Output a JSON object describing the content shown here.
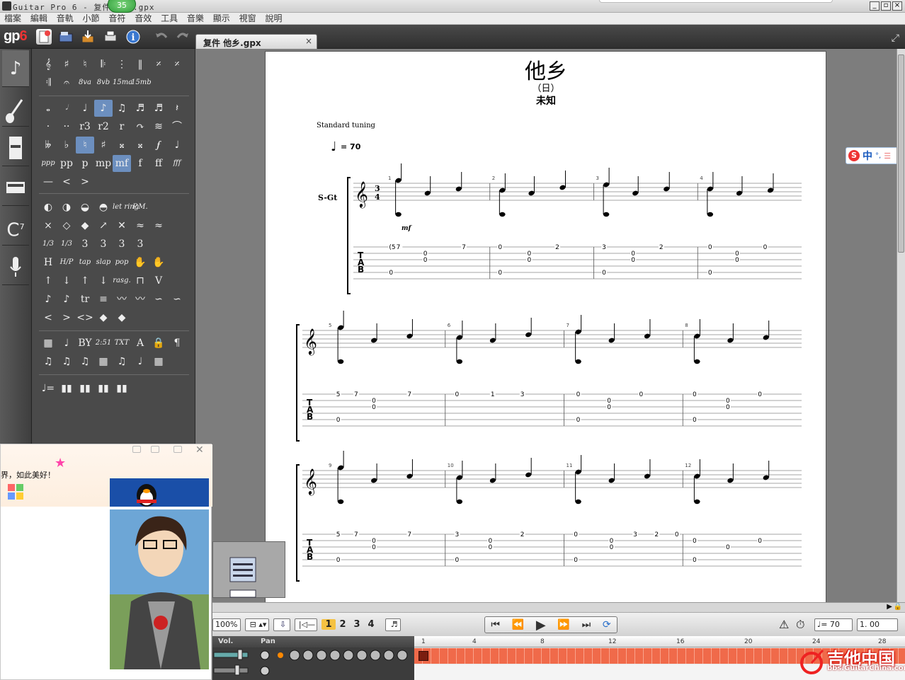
{
  "window": {
    "title": "Guitar Pro 6 - 复件 他乡.gpx",
    "notif_count": "35"
  },
  "menu": [
    "檔案",
    "編輯",
    "音軌",
    "小節",
    "音符",
    "音效",
    "工具",
    "音樂",
    "顯示",
    "視窗",
    "說明"
  ],
  "logo": {
    "text": "gp",
    "num": "6"
  },
  "tab": {
    "label": "复件 他乡.gpx",
    "close": "×"
  },
  "score": {
    "title": "他乡",
    "subtitle": "（日）",
    "artist": "未知",
    "tuning": "Standard tuning",
    "tempo": "= 70",
    "track_label": "S-Gt",
    "time_sig_top": "3",
    "time_sig_bottom": "4",
    "dynamic": "mf",
    "tab_letters": [
      "T",
      "A",
      "B"
    ],
    "systems": [
      {
        "bars": [
          1,
          2,
          3,
          4
        ],
        "tab": [
          {
            "bar": 1,
            "frets": [
              {
                "x": 0.05,
                "s": 1,
                "v": "(5)"
              },
              {
                "x": 0.12,
                "s": 1,
                "v": "7"
              },
              {
                "x": 0.38,
                "s": 2,
                "v": "0"
              },
              {
                "x": 0.38,
                "s": 3,
                "v": "0"
              },
              {
                "x": 0.75,
                "s": 1,
                "v": "7"
              },
              {
                "x": 0.05,
                "s": 5,
                "v": "0"
              }
            ]
          },
          {
            "bar": 2,
            "frets": [
              {
                "x": 0.1,
                "s": 1,
                "v": "0"
              },
              {
                "x": 0.38,
                "s": 2,
                "v": "0"
              },
              {
                "x": 0.38,
                "s": 3,
                "v": "0"
              },
              {
                "x": 0.65,
                "s": 1,
                "v": "2"
              },
              {
                "x": 0.1,
                "s": 5,
                "v": "0"
              }
            ]
          },
          {
            "bar": 3,
            "frets": [
              {
                "x": 0.1,
                "s": 1,
                "v": "3"
              },
              {
                "x": 0.38,
                "s": 2,
                "v": "0"
              },
              {
                "x": 0.38,
                "s": 3,
                "v": "0"
              },
              {
                "x": 0.65,
                "s": 1,
                "v": "2"
              },
              {
                "x": 0.1,
                "s": 5,
                "v": "0"
              }
            ]
          },
          {
            "bar": 4,
            "frets": [
              {
                "x": 0.12,
                "s": 1,
                "v": "0"
              },
              {
                "x": 0.38,
                "s": 2,
                "v": "0"
              },
              {
                "x": 0.38,
                "s": 3,
                "v": "0"
              },
              {
                "x": 0.65,
                "s": 1,
                "v": "0"
              },
              {
                "x": 0.12,
                "s": 5,
                "v": "0"
              }
            ]
          }
        ]
      },
      {
        "bars": [
          5,
          6,
          7,
          8
        ],
        "tab": [
          {
            "bar": 5,
            "frets": [
              {
                "x": 0.1,
                "s": 1,
                "v": "5"
              },
              {
                "x": 0.25,
                "s": 1,
                "v": "7"
              },
              {
                "x": 0.4,
                "s": 2,
                "v": "0"
              },
              {
                "x": 0.4,
                "s": 3,
                "v": "0"
              },
              {
                "x": 0.7,
                "s": 1,
                "v": "7"
              },
              {
                "x": 0.1,
                "s": 5,
                "v": "0"
              }
            ]
          },
          {
            "bar": 6,
            "frets": [
              {
                "x": 0.1,
                "s": 1,
                "v": "0"
              },
              {
                "x": 0.4,
                "s": 1,
                "v": "1"
              },
              {
                "x": 0.65,
                "s": 1,
                "v": "3"
              }
            ]
          },
          {
            "bar": 7,
            "frets": [
              {
                "x": 0.12,
                "s": 1,
                "v": "0"
              },
              {
                "x": 0.38,
                "s": 2,
                "v": "0"
              },
              {
                "x": 0.38,
                "s": 3,
                "v": "0"
              },
              {
                "x": 0.65,
                "s": 1,
                "v": "0"
              },
              {
                "x": 0.12,
                "s": 5,
                "v": "0"
              }
            ]
          },
          {
            "bar": 8,
            "frets": [
              {
                "x": 0.1,
                "s": 1,
                "v": "0"
              },
              {
                "x": 0.38,
                "s": 2,
                "v": "0"
              },
              {
                "x": 0.38,
                "s": 3,
                "v": "0"
              },
              {
                "x": 0.65,
                "s": 1,
                "v": "0"
              },
              {
                "x": 0.1,
                "s": 5,
                "v": "0"
              }
            ]
          }
        ]
      },
      {
        "bars": [
          9,
          10,
          11,
          12
        ],
        "tab": [
          {
            "bar": 9,
            "frets": [
              {
                "x": 0.1,
                "s": 1,
                "v": "5"
              },
              {
                "x": 0.25,
                "s": 1,
                "v": "7"
              },
              {
                "x": 0.4,
                "s": 2,
                "v": "0"
              },
              {
                "x": 0.4,
                "s": 3,
                "v": "0"
              },
              {
                "x": 0.7,
                "s": 1,
                "v": "7"
              },
              {
                "x": 0.1,
                "s": 5,
                "v": "0"
              }
            ]
          },
          {
            "bar": 10,
            "frets": [
              {
                "x": 0.1,
                "s": 1,
                "v": "3"
              },
              {
                "x": 0.38,
                "s": 2,
                "v": "0"
              },
              {
                "x": 0.38,
                "s": 3,
                "v": "0"
              },
              {
                "x": 0.65,
                "s": 1,
                "v": "2"
              },
              {
                "x": 0.1,
                "s": 5,
                "v": "0"
              }
            ]
          },
          {
            "bar": 11,
            "frets": [
              {
                "x": 0.1,
                "s": 1,
                "v": "0"
              },
              {
                "x": 0.4,
                "s": 2,
                "v": "0"
              },
              {
                "x": 0.4,
                "s": 3,
                "v": "0"
              },
              {
                "x": 0.6,
                "s": 1,
                "v": "3"
              },
              {
                "x": 0.78,
                "s": 1,
                "v": "2"
              },
              {
                "x": 0.95,
                "s": 1,
                "v": "0"
              },
              {
                "x": 0.1,
                "s": 5,
                "v": "0"
              }
            ]
          },
          {
            "bar": 12,
            "frets": [
              {
                "x": 0.1,
                "s": 2,
                "v": "0"
              },
              {
                "x": 0.38,
                "s": 3,
                "v": "0"
              },
              {
                "x": 0.65,
                "s": 2,
                "v": "0"
              },
              {
                "x": 0.1,
                "s": 5,
                "v": "0"
              }
            ]
          }
        ]
      }
    ]
  },
  "palette": {
    "row1": [
      "𝄞",
      "♯",
      "♮",
      "𝄆",
      "⋮",
      "‖",
      "𝄎",
      "𝄎"
    ],
    "row2": [
      "𝄇",
      "𝄐",
      "8va",
      "8vb",
      "15ma",
      "15mb"
    ],
    "row3": [
      "𝅝",
      "𝅗𝅥",
      "♩",
      "♪",
      "♫",
      "♬",
      "♬",
      "𝄽"
    ],
    "row4": [
      "·",
      "··",
      "r3",
      "r2",
      "r",
      "↷",
      "≋",
      "⌒"
    ],
    "row5": [
      "𝄫",
      "♭",
      "♮",
      "♯",
      "𝄪",
      "𝄪",
      "𝆑",
      "♩"
    ],
    "row6": [
      "ppp",
      "pp",
      "p",
      "mp",
      "mf",
      "f",
      "ff",
      "fff"
    ],
    "row7": [
      "—",
      "<",
      ">"
    ],
    "row8": [
      "◐",
      "◑",
      "◒",
      "◓",
      "let ring",
      "P.M."
    ],
    "row9": [
      "×",
      "◇",
      "◆",
      "↗",
      "✕",
      "≈",
      "≈"
    ],
    "row10": [
      "1/3",
      "1/3",
      "3",
      "3",
      "3",
      "3"
    ],
    "row11": [
      "H",
      "H/P",
      "tap",
      "slap",
      "pop",
      "✋",
      "✋"
    ],
    "row12": [
      "↑",
      "↓",
      "↑",
      "↓",
      "rasg.",
      "⊓",
      "V"
    ],
    "row13": [
      "♪",
      "♪",
      "tr",
      "≡",
      "〰",
      "〰",
      "∽",
      "∽"
    ],
    "row14": [
      "<",
      ">",
      "<>",
      "◆",
      "◆"
    ],
    "row15": [
      "▦",
      "♩",
      "BY",
      "2:51",
      "TXT",
      "A",
      "🔒",
      "¶"
    ],
    "row16": [
      "♫",
      "♫",
      "♫",
      "▦",
      "♫",
      "♩",
      "▦"
    ],
    "row17": [
      "♩=",
      "▮▮",
      "▮▮",
      "▮▮",
      "▮▮"
    ]
  },
  "bottom": {
    "zoom": "100%",
    "voices": [
      "1",
      "2",
      "3",
      "4"
    ],
    "tempo": "♩= 70",
    "speed": "1. 00"
  },
  "mixer": {
    "vol": "Vol.",
    "pan": "Pan"
  },
  "ruler": [
    "1",
    "4",
    "8",
    "12",
    "16",
    "20",
    "24",
    "28"
  ],
  "qq": {
    "message": "界，如此美好！"
  },
  "ime": {
    "lang": "中"
  },
  "watermark": {
    "name": "吉他中国",
    "url": "bbs.GuitarChina.com"
  }
}
